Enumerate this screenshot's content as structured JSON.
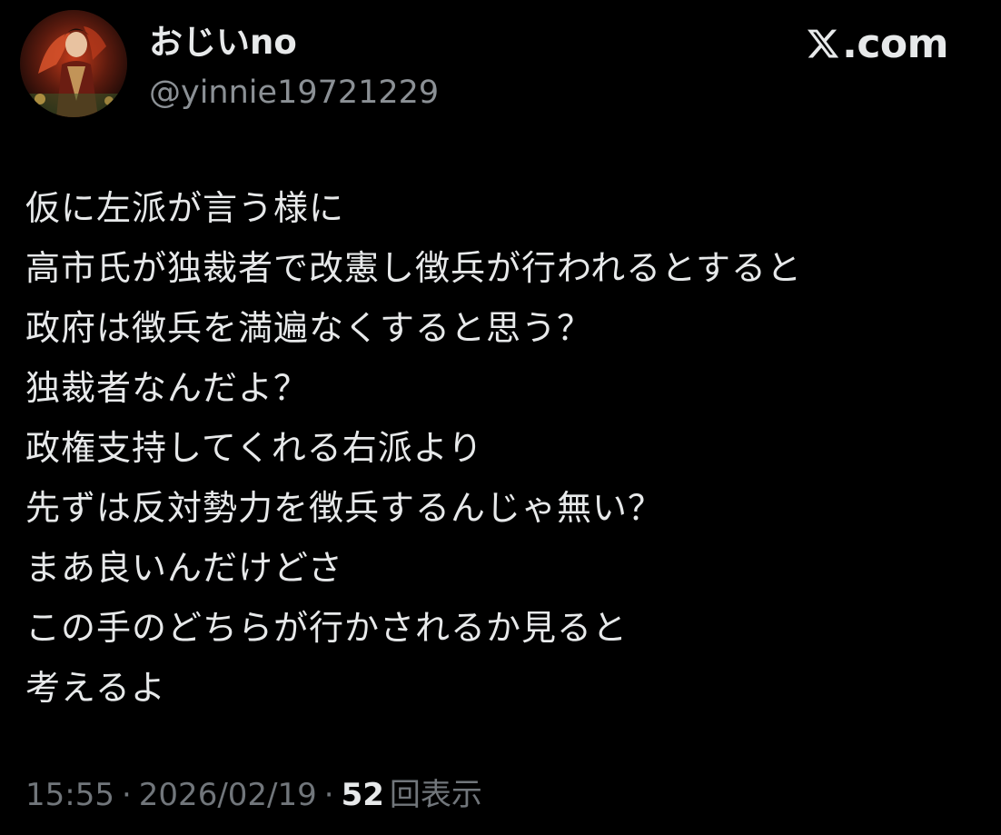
{
  "author": {
    "display_name": "おじいno",
    "handle": "@yinnie19721229"
  },
  "brand": {
    "label": ".com",
    "icon": "x-logo-icon"
  },
  "tweet": {
    "lines": [
      "仮に左派が言う様に",
      "高市氏が独裁者で改憲し徴兵が行われるとすると",
      "政府は徴兵を満遍なくすると思う？",
      "独裁者なんだよ？",
      "政権支持してくれる右派より",
      "先ずは反対勢力を徴兵するんじゃ無い？",
      "まあ良いんだけどさ",
      "この手のどちらが行かされるか見ると",
      "考えるよ"
    ]
  },
  "meta": {
    "time": "15:55",
    "separator": "·",
    "date": "2026/02/19",
    "views_count": "52",
    "views_label": "回表示"
  },
  "colors": {
    "background": "#000000",
    "text": "#e7e9ea",
    "secondary": "#71767b"
  }
}
